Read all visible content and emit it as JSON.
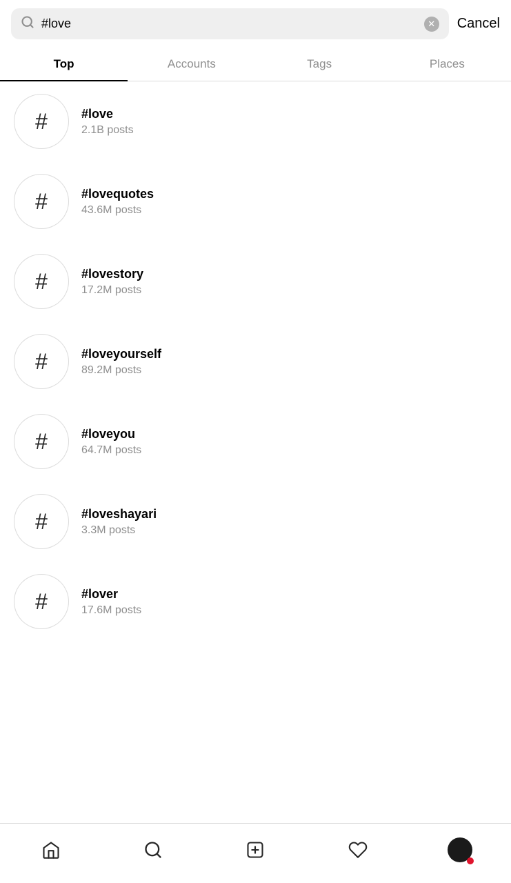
{
  "search": {
    "query": "#love",
    "clear_label": "×",
    "cancel_label": "Cancel",
    "placeholder": "Search"
  },
  "tabs": [
    {
      "id": "top",
      "label": "Top",
      "active": true
    },
    {
      "id": "accounts",
      "label": "Accounts",
      "active": false
    },
    {
      "id": "tags",
      "label": "Tags",
      "active": false
    },
    {
      "id": "places",
      "label": "Places",
      "active": false
    }
  ],
  "results": [
    {
      "tag": "#love",
      "count": "2.1B posts"
    },
    {
      "tag": "#lovequotes",
      "count": "43.6M posts"
    },
    {
      "tag": "#lovestory",
      "count": "17.2M posts"
    },
    {
      "tag": "#loveyourself",
      "count": "89.2M posts"
    },
    {
      "tag": "#loveyou",
      "count": "64.7M posts"
    },
    {
      "tag": "#loveshayari",
      "count": "3.3M posts"
    },
    {
      "tag": "#lover",
      "count": "17.6M posts"
    }
  ],
  "nav": {
    "home_label": "Home",
    "search_label": "Search",
    "create_label": "Create",
    "activity_label": "Activity",
    "profile_label": "Profile"
  }
}
